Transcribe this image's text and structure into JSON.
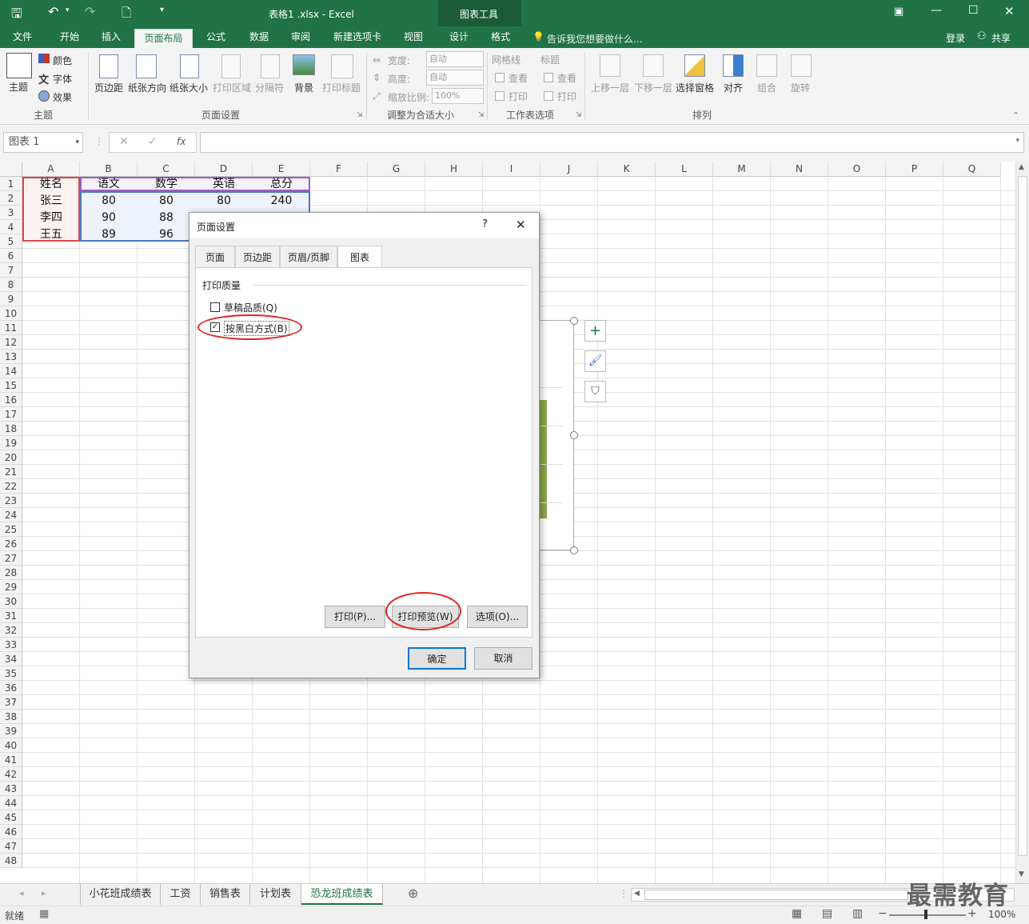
{
  "titlebar": {
    "doc_title": "表格1 .xlsx - Excel",
    "context_title": "图表工具",
    "save_icon": "save-icon",
    "undo_icon": "undo-icon",
    "redo_icon": "redo-icon",
    "new_icon": "new-file-icon"
  },
  "tabs": [
    {
      "label": "文件"
    },
    {
      "label": "开始"
    },
    {
      "label": "插入"
    },
    {
      "label": "页面布局"
    },
    {
      "label": "公式"
    },
    {
      "label": "数据"
    },
    {
      "label": "审阅"
    },
    {
      "label": "新建选项卡"
    },
    {
      "label": "视图"
    },
    {
      "label": "设计"
    },
    {
      "label": "格式"
    }
  ],
  "tellme": "告诉我您想要做什么...",
  "signin": "登录",
  "share": "共享",
  "ribbon": {
    "theme": {
      "main": "主题",
      "colors": "颜色",
      "fonts": "字体",
      "effects": "效果",
      "group": "主题"
    },
    "page_setup": {
      "margins": "页边距",
      "orientation": "纸张方向",
      "size": "纸张大小",
      "print_area": "打印区域",
      "breaks": "分隔符",
      "background": "背景",
      "print_titles": "打印标题",
      "group": "页面设置"
    },
    "scale": {
      "width_label": "宽度:",
      "width_val": "自动",
      "height_label": "高度:",
      "height_val": "自动",
      "scale_label": "缩放比例:",
      "scale_val": "100%",
      "group": "调整为合适大小"
    },
    "sheet_options": {
      "gridlines": "网格线",
      "headings": "标题",
      "view": "查看",
      "print": "打印",
      "view2": "查看",
      "print2": "打印",
      "group": "工作表选项"
    },
    "arrange": {
      "bring_forward": "上移一层",
      "send_backward": "下移一层",
      "selection_pane": "选择窗格",
      "align": "对齐",
      "group_btn": "组合",
      "rotate": "旋转",
      "group": "排列"
    }
  },
  "formula_bar": {
    "name_box": "图表 1",
    "fx": "fx",
    "value": ""
  },
  "columns": [
    "A",
    "B",
    "C",
    "D",
    "E",
    "F",
    "G",
    "H",
    "I",
    "J",
    "K",
    "L",
    "M",
    "N",
    "O",
    "P",
    "Q"
  ],
  "rows": [
    "1",
    "2",
    "3",
    "4",
    "5",
    "6",
    "7",
    "8",
    "9",
    "10",
    "11",
    "12",
    "13",
    "14",
    "15",
    "16",
    "17",
    "18",
    "19",
    "20",
    "21",
    "22",
    "23",
    "24",
    "25",
    "26",
    "27",
    "28",
    "29",
    "30",
    "31",
    "32",
    "33",
    "34",
    "35",
    "36",
    "37",
    "38",
    "39",
    "40",
    "41",
    "42",
    "43",
    "44",
    "45",
    "46",
    "47",
    "48"
  ],
  "table": {
    "headers": [
      "姓名",
      "语文",
      "数学",
      "英语",
      "总分"
    ],
    "rows": [
      [
        "张三",
        "80",
        "80",
        "80",
        "240"
      ],
      [
        "李四",
        "90",
        "88",
        "",
        ""
      ],
      [
        "王五",
        "89",
        "96",
        "",
        ""
      ]
    ]
  },
  "dialog": {
    "title": "页面设置",
    "help": "?",
    "close": "✕",
    "tabs": [
      {
        "label": "页面"
      },
      {
        "label": "页边距"
      },
      {
        "label": "页眉/页脚"
      },
      {
        "label": "图表"
      }
    ],
    "section": "打印质量",
    "draft": {
      "label": "草稿品质(Q)",
      "checked": false
    },
    "bw": {
      "label": "按黑白方式(B)",
      "checked": true
    },
    "print_btn": "打印(P)...",
    "preview_btn": "打印预览(W)",
    "options_btn": "选项(O)...",
    "ok": "确定",
    "cancel": "取消"
  },
  "sheets": [
    {
      "label": "小花班成绩表"
    },
    {
      "label": "工资"
    },
    {
      "label": "销售表"
    },
    {
      "label": "计划表"
    },
    {
      "label": "恐龙班成绩表"
    }
  ],
  "status": {
    "ready": "就绪",
    "zoom": "100%"
  },
  "watermark": "最需教育",
  "colors": {
    "excel_green": "#217346",
    "accent_red": "#e02424",
    "chart_bar": "#8aa84a"
  }
}
